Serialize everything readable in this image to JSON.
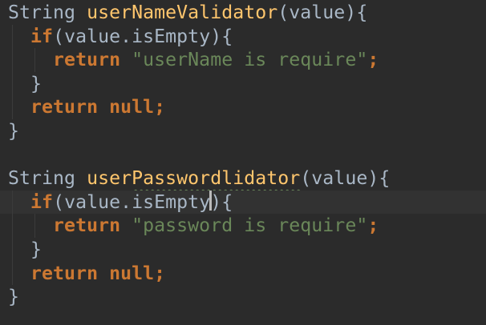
{
  "editor": {
    "colors": {
      "background": "#2b2b2b",
      "text": "#a9b7c6",
      "keyword": "#cc7832",
      "method": "#ffc66d",
      "string": "#6a8759",
      "current_line": "#323232"
    },
    "current_line_index": 8,
    "lines": [
      {
        "indent": 0,
        "tokens": [
          {
            "t": "String ",
            "c": "plain"
          },
          {
            "t": "userNameValidator",
            "c": "fn"
          },
          {
            "t": "(value){",
            "c": "plain"
          }
        ]
      },
      {
        "indent": 1,
        "tokens": [
          {
            "t": "if",
            "c": "kw"
          },
          {
            "t": "(value.isEmpty){",
            "c": "plain"
          }
        ]
      },
      {
        "indent": 2,
        "tokens": [
          {
            "t": "return ",
            "c": "kw"
          },
          {
            "t": "\"userName is require\"",
            "c": "str"
          },
          {
            "t": ";",
            "c": "kw"
          }
        ]
      },
      {
        "indent": 1,
        "tokens": [
          {
            "t": "}",
            "c": "plain"
          }
        ]
      },
      {
        "indent": 1,
        "tokens": [
          {
            "t": "return null;",
            "c": "kw"
          }
        ]
      },
      {
        "indent": 0,
        "tokens": [
          {
            "t": "}",
            "c": "plain"
          }
        ]
      },
      {
        "indent": 0,
        "tokens": []
      },
      {
        "indent": 0,
        "tokens": [
          {
            "t": "String ",
            "c": "plain"
          },
          {
            "t": "user",
            "c": "fn"
          },
          {
            "t": "Passwordlidator",
            "c": "fn squiggle"
          },
          {
            "t": "(value){",
            "c": "plain"
          }
        ]
      },
      {
        "indent": 1,
        "tokens": [
          {
            "t": "if",
            "c": "kw"
          },
          {
            "t": "(value.isEmpty",
            "c": "plain"
          },
          {
            "t": "",
            "c": "caret"
          },
          {
            "t": "){",
            "c": "plain"
          }
        ]
      },
      {
        "indent": 2,
        "tokens": [
          {
            "t": "return ",
            "c": "kw"
          },
          {
            "t": "\"password is require\"",
            "c": "str"
          },
          {
            "t": ";",
            "c": "kw"
          }
        ]
      },
      {
        "indent": 1,
        "tokens": [
          {
            "t": "}",
            "c": "plain"
          }
        ]
      },
      {
        "indent": 1,
        "tokens": [
          {
            "t": "return null;",
            "c": "kw"
          }
        ]
      },
      {
        "indent": 0,
        "tokens": [
          {
            "t": "}",
            "c": "plain"
          }
        ]
      }
    ]
  }
}
